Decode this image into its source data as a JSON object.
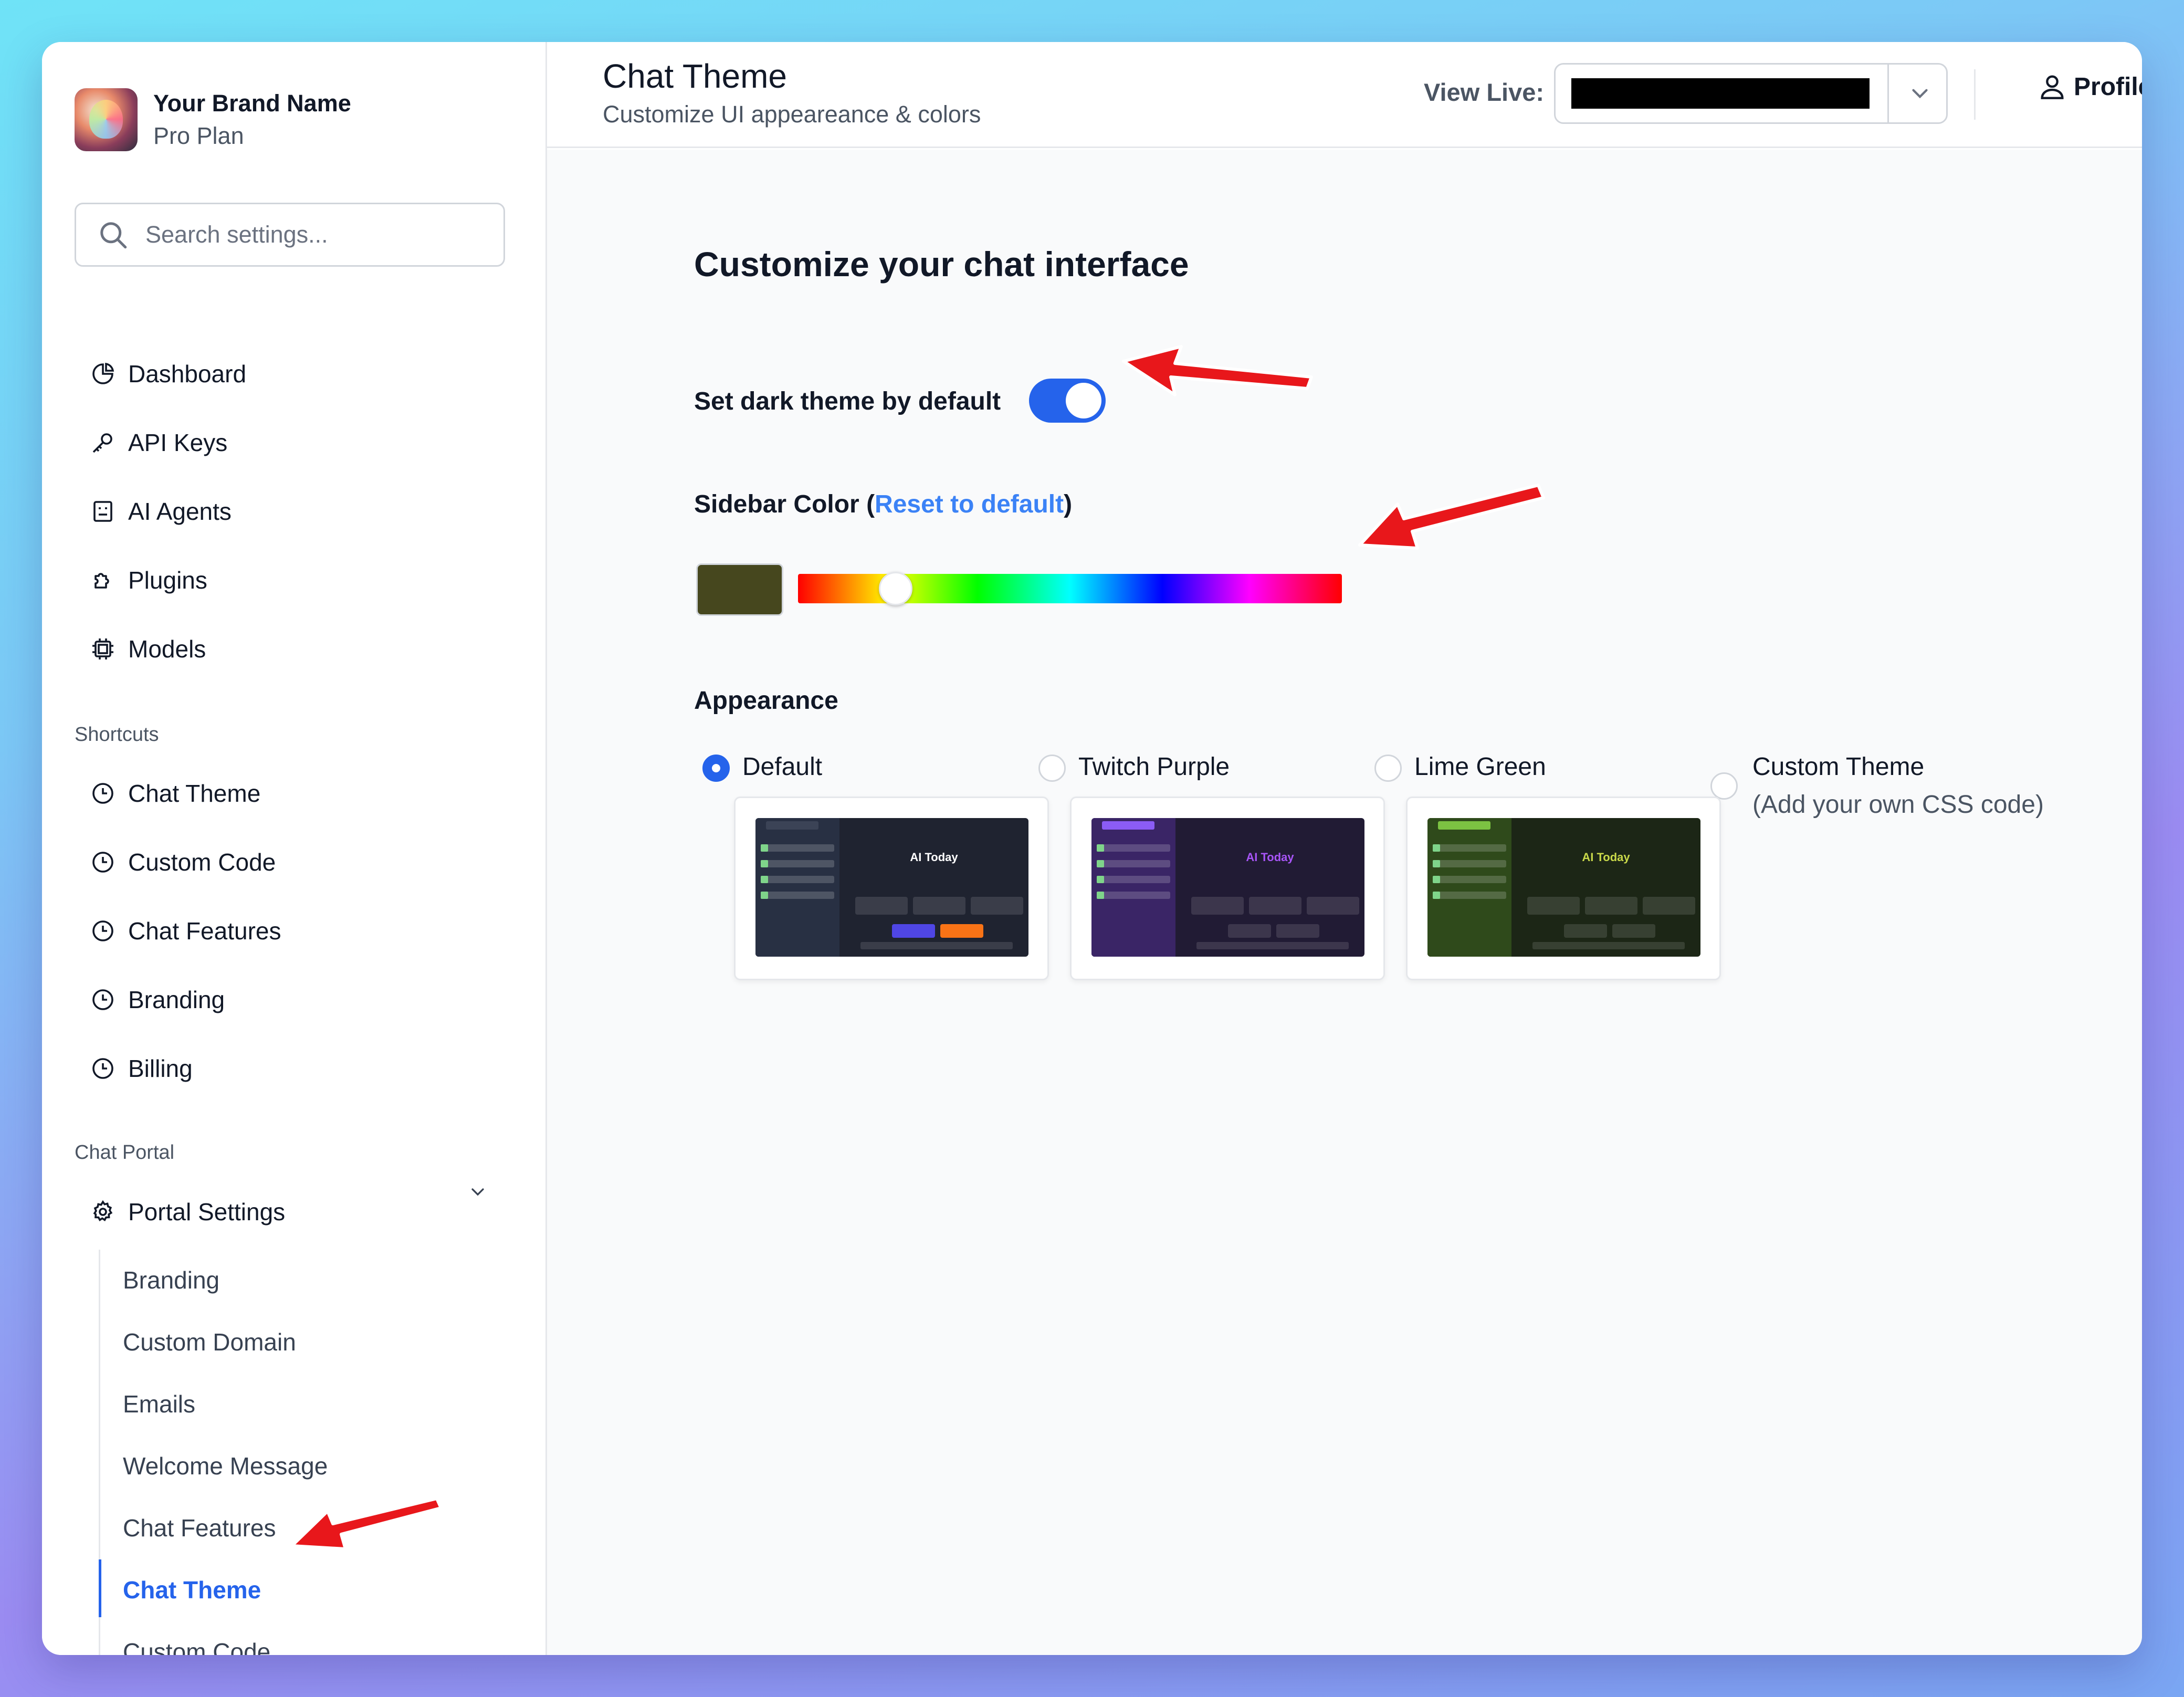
{
  "brand": {
    "name": "Your Brand Name",
    "plan": "Pro Plan"
  },
  "search": {
    "placeholder": "Search settings..."
  },
  "nav": {
    "main": [
      {
        "label": "Dashboard",
        "icon": "pie-chart-icon"
      },
      {
        "label": "API Keys",
        "icon": "key-icon"
      },
      {
        "label": "AI Agents",
        "icon": "bot-icon"
      },
      {
        "label": "Plugins",
        "icon": "puzzle-icon"
      },
      {
        "label": "Models",
        "icon": "cpu-icon"
      }
    ],
    "shortcuts_label": "Shortcuts",
    "shortcuts": [
      {
        "label": "Chat Theme",
        "icon": "clock-icon"
      },
      {
        "label": "Custom Code",
        "icon": "clock-icon"
      },
      {
        "label": "Chat Features",
        "icon": "clock-icon"
      },
      {
        "label": "Branding",
        "icon": "clock-icon"
      },
      {
        "label": "Billing",
        "icon": "clock-icon"
      }
    ],
    "portal_label": "Chat Portal",
    "portal_settings": {
      "label": "Portal Settings",
      "icon": "gear-icon",
      "expanded": true
    },
    "portal_items": [
      {
        "label": "Branding",
        "active": false
      },
      {
        "label": "Custom Domain",
        "active": false
      },
      {
        "label": "Emails",
        "active": false
      },
      {
        "label": "Welcome Message",
        "active": false
      },
      {
        "label": "Chat Features",
        "active": false
      },
      {
        "label": "Chat Theme",
        "active": true
      },
      {
        "label": "Custom Code",
        "active": false
      }
    ]
  },
  "header": {
    "title": "Chat Theme",
    "subtitle": "Customize UI appeareance & colors",
    "view_live_label": "View Live:",
    "view_live_value": "",
    "profile_label": "Profile"
  },
  "main": {
    "heading": "Customize your chat interface",
    "dark_theme_label": "Set dark theme by default",
    "dark_theme_enabled": true,
    "sidebar_color_label": "Sidebar Color",
    "reset_link": "Reset to default",
    "sidebar_color": "#46471e",
    "hue_value": 0.18,
    "appearance_label": "Appearance",
    "themes": [
      {
        "label": "Default",
        "selected": true,
        "preview_title": "AI Today"
      },
      {
        "label": "Twitch Purple",
        "selected": false,
        "preview_title": "AI Today"
      },
      {
        "label": "Lime Green",
        "selected": false,
        "preview_title": "AI Today"
      },
      {
        "label": "Custom Theme",
        "sublabel": "(Add your own CSS code)",
        "selected": false
      }
    ]
  },
  "colors": {
    "accent": "#2563eb",
    "link": "#3b82f6",
    "annotation_arrow": "#e8171b"
  }
}
